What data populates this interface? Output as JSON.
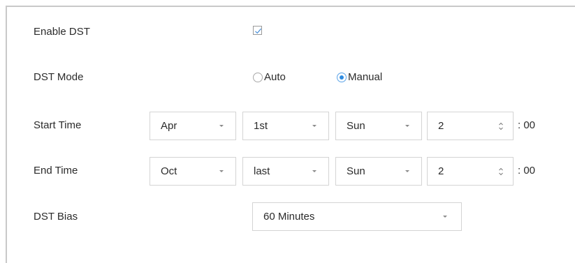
{
  "enable_dst": {
    "label": "Enable DST",
    "checked": true
  },
  "dst_mode": {
    "label": "DST Mode",
    "options": [
      {
        "label": "Auto",
        "selected": false
      },
      {
        "label": "Manual",
        "selected": true
      }
    ]
  },
  "start_time": {
    "label": "Start Time",
    "month": "Apr",
    "week": "1st",
    "day": "Sun",
    "hour": "2",
    "suffix": ": 00"
  },
  "end_time": {
    "label": "End Time",
    "month": "Oct",
    "week": "last",
    "day": "Sun",
    "hour": "2",
    "suffix": ": 00"
  },
  "dst_bias": {
    "label": "DST Bias",
    "value": "60 Minutes"
  },
  "icons": {
    "checkbox": "check-icon",
    "dropdown": "chevron-down-icon",
    "spinner": "spinner-updown-icon"
  },
  "colors": {
    "accent": "#2f8be0",
    "border": "#d4d4d4"
  }
}
